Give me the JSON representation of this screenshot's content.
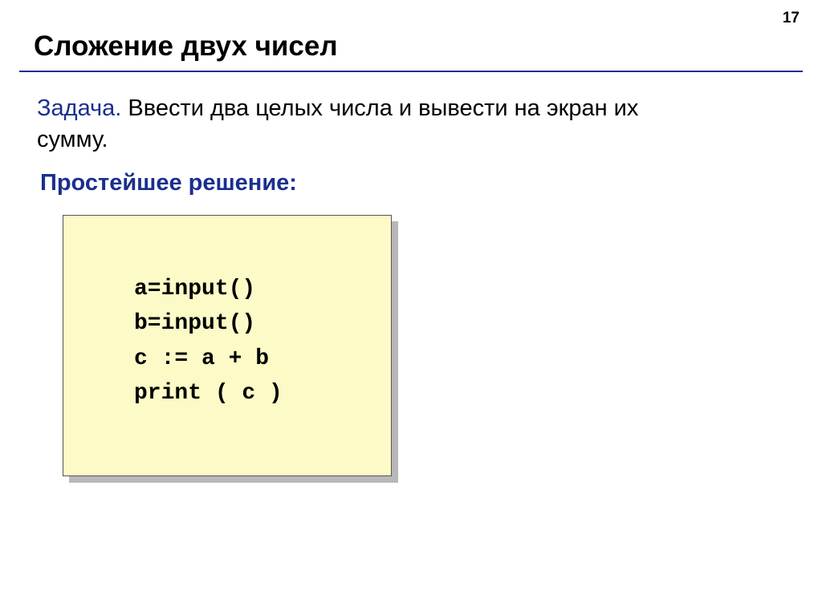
{
  "pageNumber": "17",
  "title": "Сложение двух чисел",
  "task": {
    "label": "Задача.",
    "text": " Ввести два целых числа и вывести на экран их сумму."
  },
  "solutionLabel": "Простейшее решение:",
  "code": {
    "line1": "a=input()",
    "line2": "b=input()",
    "line3": "c := a + b",
    "line4": "print ( c )"
  }
}
